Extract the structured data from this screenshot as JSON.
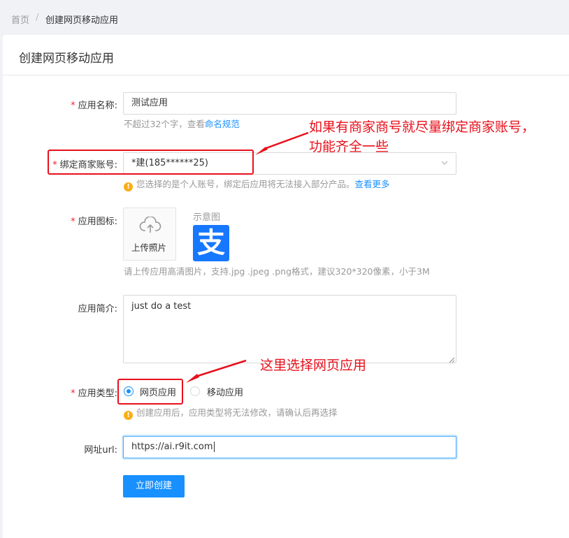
{
  "breadcrumb": {
    "home": "首页",
    "separator": "/",
    "current": "创建网页移动应用"
  },
  "page": {
    "title": "创建网页移动应用"
  },
  "form": {
    "name": {
      "label": "应用名称:",
      "value": "测试应用",
      "help_prefix": "不超过32个字，查看",
      "help_link": "命名规范"
    },
    "merchant": {
      "label": "绑定商家账号:",
      "value": "*建(185******25)",
      "warning": "您选择的是个人账号，绑定后应用将无法接入部分产品。",
      "warning_link": "查看更多"
    },
    "icon": {
      "label": "应用图标:",
      "upload_label": "上传照片",
      "sample_label": "示意图",
      "sample_glyph": "支",
      "hint": "请上传应用高清图片，支持.jpg .jpeg .png格式，建议320*320像素，小于3M"
    },
    "intro": {
      "label": "应用简介:",
      "value": "just do a test"
    },
    "type": {
      "label": "应用类型:",
      "option_web": "网页应用",
      "option_mobile": "移动应用",
      "selected": "网页应用",
      "warning": "创建应用后，应用类型将无法修改，请确认后再选择"
    },
    "url": {
      "label": "网址url:",
      "value": "https://ai.r9it.com"
    },
    "submit_label": "立即创建"
  },
  "annotations": {
    "merchant_note_line1": "如果有商家商号就尽量绑定商家账号，",
    "merchant_note_line2": "功能齐全一些",
    "type_note": "这里选择网页应用"
  },
  "colors": {
    "primary": "#1890ff",
    "required": "#f5222d",
    "warning": "#faad14",
    "annotation": "#e8101b",
    "alipay": "#1677ff"
  },
  "icons": {
    "upload": "cloud-upload-icon",
    "select": "chevron-down-icon",
    "warning": "exclamation-circle-icon"
  }
}
